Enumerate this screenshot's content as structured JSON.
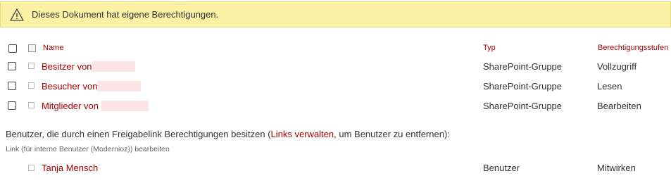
{
  "banner": {
    "icon": "warning-icon",
    "message": "Dieses Dokument hat eigene Berechtigungen."
  },
  "table": {
    "headers": {
      "name": "Name",
      "type": "Typ",
      "level": "Berechtigungsstufen"
    },
    "rows": [
      {
        "name": "Besitzer von",
        "type": "SharePoint-Gruppe",
        "level": "Vollzugriff"
      },
      {
        "name": "Besucher von",
        "type": "SharePoint-Gruppe",
        "level": "Lesen"
      },
      {
        "name": "Mitglieder von",
        "type": "SharePoint-Gruppe",
        "level": "Bearbeiten"
      }
    ]
  },
  "sharing": {
    "text_before": "Benutzer, die durch einen Freigabelink Berechtigungen besitzen (",
    "link_label": "Links verwalten",
    "text_after": ", um Benutzer zu entfernen):",
    "link_desc": "Link (für interne Benutzer (Modernioz)) bearbeiten",
    "user": {
      "name": "Tanja Mensch",
      "type": "Benutzer",
      "level": "Mitwirken"
    }
  },
  "colors": {
    "accent": "#a80000",
    "banner_bg": "#fbf2a5"
  }
}
